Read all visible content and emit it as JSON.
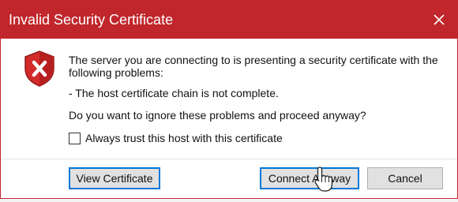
{
  "dialog": {
    "title": "Invalid Security Certificate",
    "close_glyph": "✕",
    "message_main": "The server you are connecting to is presenting a security certificate with the following problems:",
    "problem": "- The host certificate chain is not complete.",
    "question": "Do you want to ignore these problems and proceed anyway?",
    "trust_checkbox": {
      "label": "Always trust this host with this certificate",
      "checked": false
    },
    "buttons": {
      "view_certificate": "View Certificate",
      "connect_anyway": "Connect Anyway",
      "cancel": "Cancel"
    },
    "icon": "error-shield-icon",
    "colors": {
      "titlebar": "#c0262c",
      "shield": "#d32a2a",
      "focus": "#0078d7"
    }
  }
}
